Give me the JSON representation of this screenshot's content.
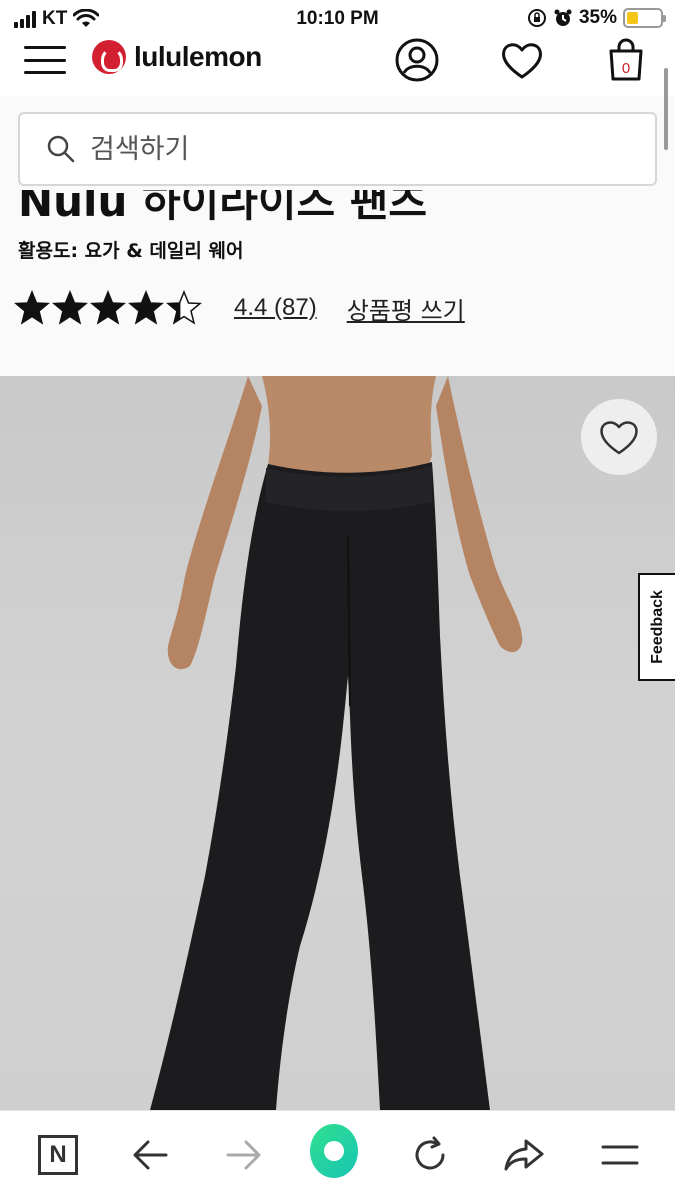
{
  "status_bar": {
    "carrier": "KT",
    "time": "10:10 PM",
    "battery_percent": "35%",
    "battery_level": 0.35
  },
  "header": {
    "brand": "lululemon",
    "cart_count": "0"
  },
  "search": {
    "placeholder": "검색하기"
  },
  "product": {
    "title": "Nulu 하이라이즈 팬츠",
    "activity": "활용도: 요가 & 데일리 웨어",
    "rating_value": 4.4,
    "rating_text": "4.4 (87)",
    "review_link": "상품평 쓰기"
  },
  "image": {
    "feedback_label": "Feedback"
  },
  "toolbar": {
    "n_label": "N"
  },
  "colors": {
    "brand_red": "#d22030",
    "battery_fill": "#f5c518",
    "accent_green": "#2fe08f"
  }
}
